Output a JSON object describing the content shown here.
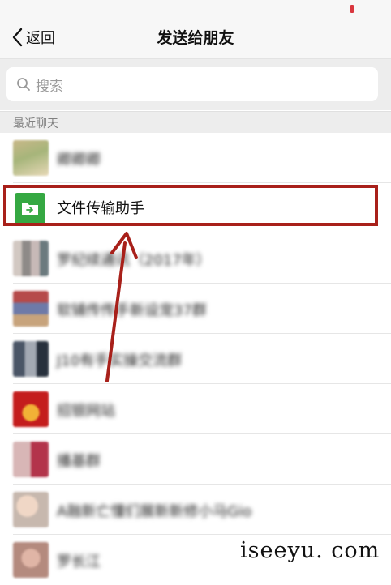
{
  "nav": {
    "back_label": "返回",
    "title": "发送给朋友"
  },
  "search": {
    "placeholder": "搜索"
  },
  "section": {
    "recent_label": "最近聊天"
  },
  "chats": [
    {
      "name": "卿卿卿"
    },
    {
      "name": "文件传输助手"
    },
    {
      "name": "罗纪续通讯（2017年）"
    },
    {
      "name": "软铺传传手新设宠37群"
    },
    {
      "name": "J10有手实操交流群"
    },
    {
      "name": "招银网站"
    },
    {
      "name": "播基群"
    },
    {
      "name": "A融新亡懂们展新新修小马Gio"
    },
    {
      "name": "罗长江"
    }
  ],
  "watermark": "iseeyu. com",
  "colors": {
    "highlight": "#a8201a",
    "file_helper": "#35a842",
    "nav_bg": "#f7f7f7"
  }
}
